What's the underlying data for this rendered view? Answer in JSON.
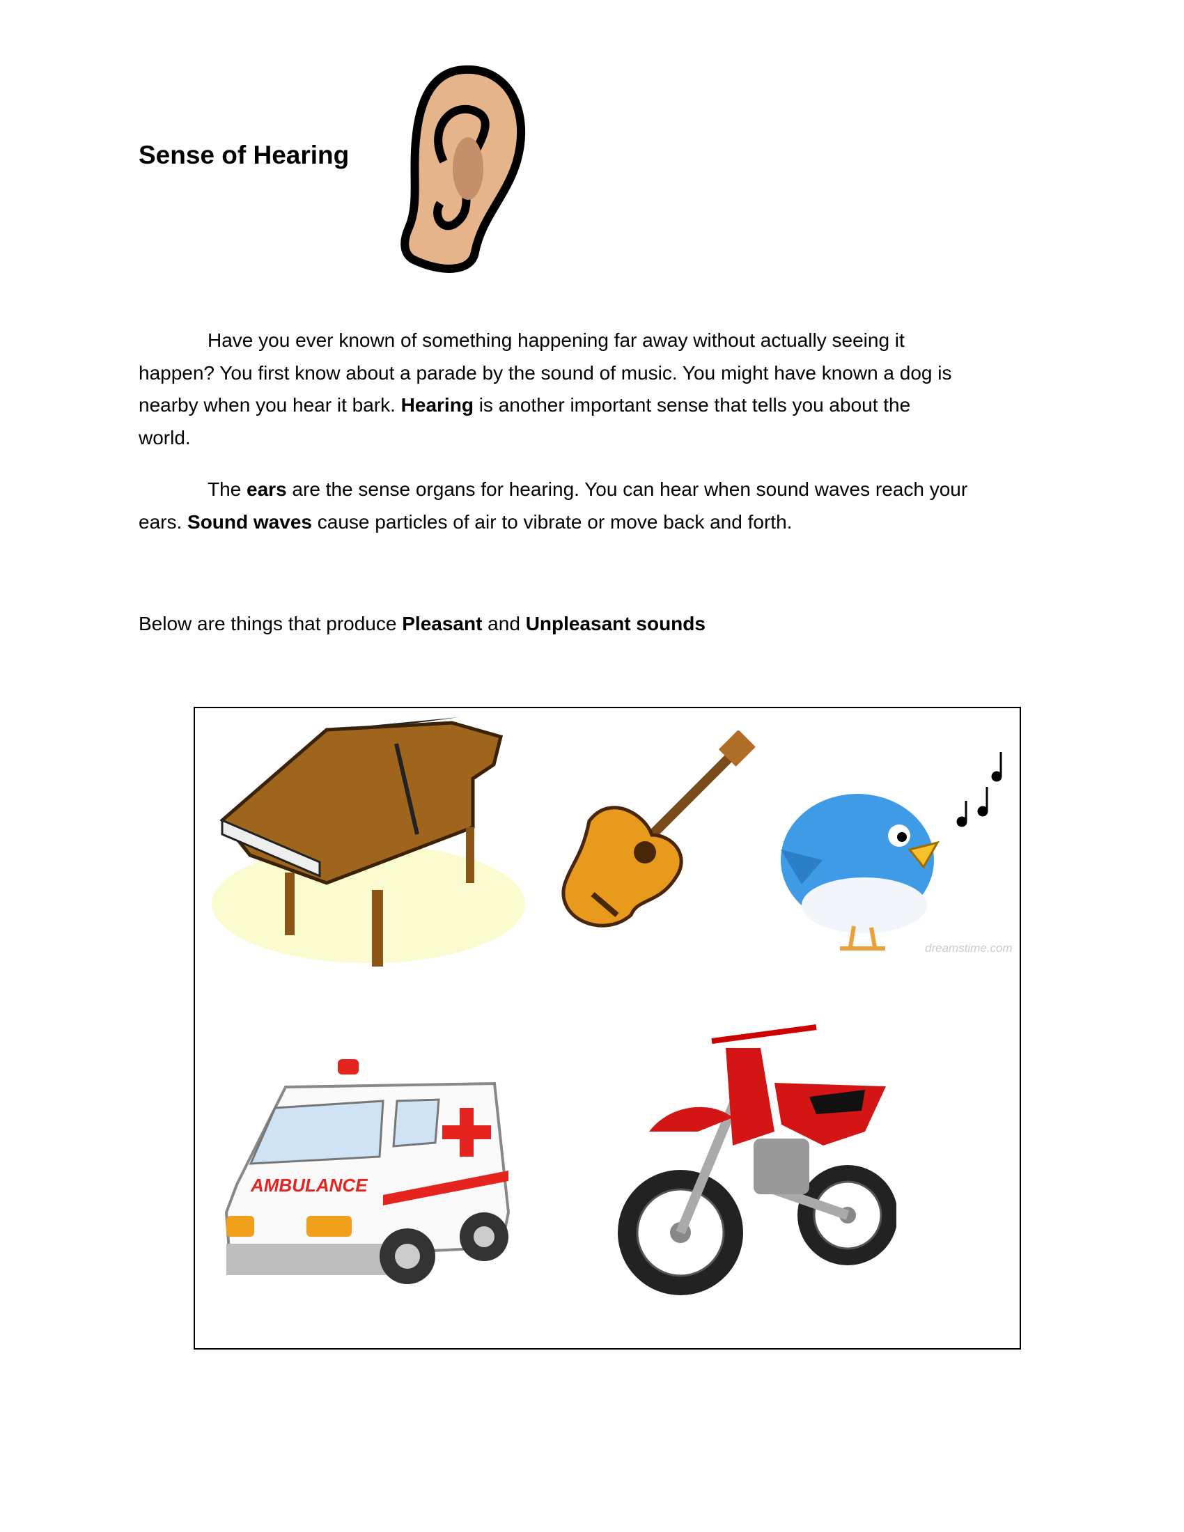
{
  "title": "Sense of Hearing",
  "paragraph1": {
    "l1": "Have you ever known of something happening far away without actually seeing it",
    "l2": "happen? You first know about a parade by the sound of music. You might have known a dog is",
    "l3a": "nearby when you hear it bark. ",
    "l3b": "Hearing",
    "l3c": " is another important sense that tells you about the",
    "l4": "world."
  },
  "paragraph2": {
    "l1a": "The ",
    "l1b": "ears",
    "l1c": " are the sense organs for hearing. You can hear when sound waves reach your",
    "l2a": "ears. ",
    "l2b": "Sound waves",
    "l2c": " cause particles of air to vibrate or move back and forth."
  },
  "paragraph3": {
    "a": "Below are things that produce ",
    "b": "Pleasant",
    "c": " and ",
    "d": "Unpleasant sounds"
  },
  "images": {
    "ear": "ear-icon",
    "piano": "piano",
    "guitar": "guitar",
    "bird": "singing-bird",
    "ambulance": "ambulance",
    "ambulance_text": "AMBULANCE",
    "motorcycle": "motorcycle",
    "watermark": "dreamstime.com"
  }
}
